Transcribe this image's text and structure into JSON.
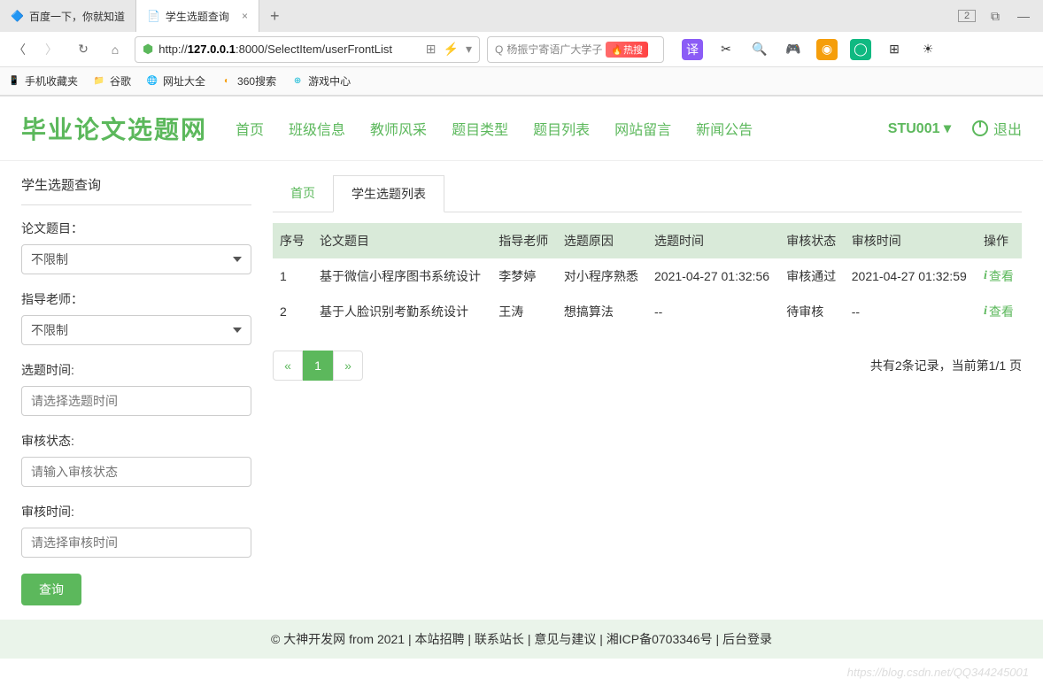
{
  "browser": {
    "tabs": [
      {
        "title": "百度一下，你就知道"
      },
      {
        "title": "学生选题查询"
      }
    ],
    "window_count": "2",
    "url_prefix": "http://",
    "url_host": "127.0.0.1",
    "url_path": ":8000/SelectItem/userFrontList",
    "search_placeholder": "杨振宁寄语广大学子",
    "hot_label": "热搜",
    "bookmarks": [
      {
        "label": "手机收藏夹"
      },
      {
        "label": "谷歌"
      },
      {
        "label": "网址大全"
      },
      {
        "label": "360搜索"
      },
      {
        "label": "游戏中心"
      }
    ]
  },
  "header": {
    "logo": "毕业论文选题网",
    "nav": [
      "首页",
      "班级信息",
      "教师风采",
      "题目类型",
      "题目列表",
      "网站留言",
      "新闻公告"
    ],
    "user": "STU001",
    "logout": "退出"
  },
  "sidebar": {
    "title": "学生选题查询",
    "labels": {
      "topic": "论文题目：",
      "teacher": "指导老师：",
      "select_time": "选题时间:",
      "audit_status": "审核状态:",
      "audit_time": "审核时间:"
    },
    "option_unlimited": "不限制",
    "placeholders": {
      "select_time": "请选择选题时间",
      "audit_status": "请输入审核状态",
      "audit_time": "请选择审核时间"
    },
    "search_btn": "查询"
  },
  "main": {
    "breadcrumb": {
      "home": "首页",
      "current": "学生选题列表"
    },
    "columns": [
      "序号",
      "论文题目",
      "指导老师",
      "选题原因",
      "选题时间",
      "审核状态",
      "审核时间",
      "操作"
    ],
    "rows": [
      {
        "no": "1",
        "title": "基于微信小程序图书系统设计",
        "teacher": "李梦婷",
        "reason": "对小程序熟悉",
        "select_time": "2021-04-27 01:32:56",
        "status": "审核通过",
        "audit_time": "2021-04-27 01:32:59"
      },
      {
        "no": "2",
        "title": "基于人脸识别考勤系统设计",
        "teacher": "王涛",
        "reason": "想搞算法",
        "select_time": "--",
        "status": "待审核",
        "audit_time": "--"
      }
    ],
    "action_label": "查看",
    "pagination": {
      "prev": "«",
      "pages": [
        "1"
      ],
      "next": "»"
    },
    "page_info": "共有2条记录，当前第1/1 页"
  },
  "footer": {
    "text": "© 大神开发网 from 2021 | 本站招聘 | 联系站长 | 意见与建议 | 湘ICP备0703346号 | 后台登录"
  },
  "watermark": "https://blog.csdn.net/QQ344245001"
}
